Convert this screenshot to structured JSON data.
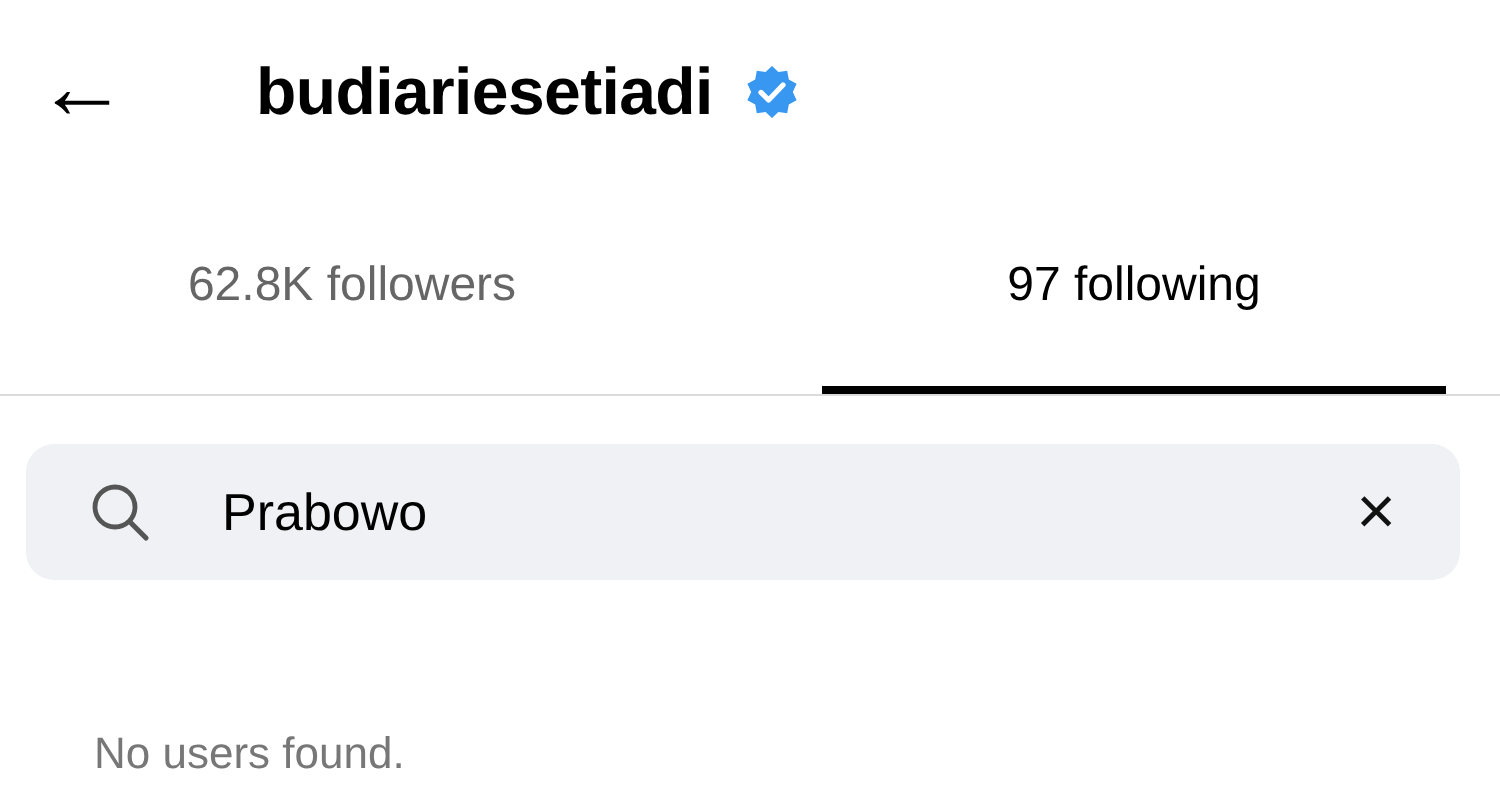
{
  "header": {
    "back": "←",
    "username": "budiariesetiadi",
    "verified": true
  },
  "tabs": [
    {
      "label": "62.8K followers",
      "selected": false
    },
    {
      "label": "97 following",
      "selected": true
    }
  ],
  "search": {
    "value": "Prabowo",
    "clear": "×"
  },
  "results": {
    "message": "No users found."
  }
}
